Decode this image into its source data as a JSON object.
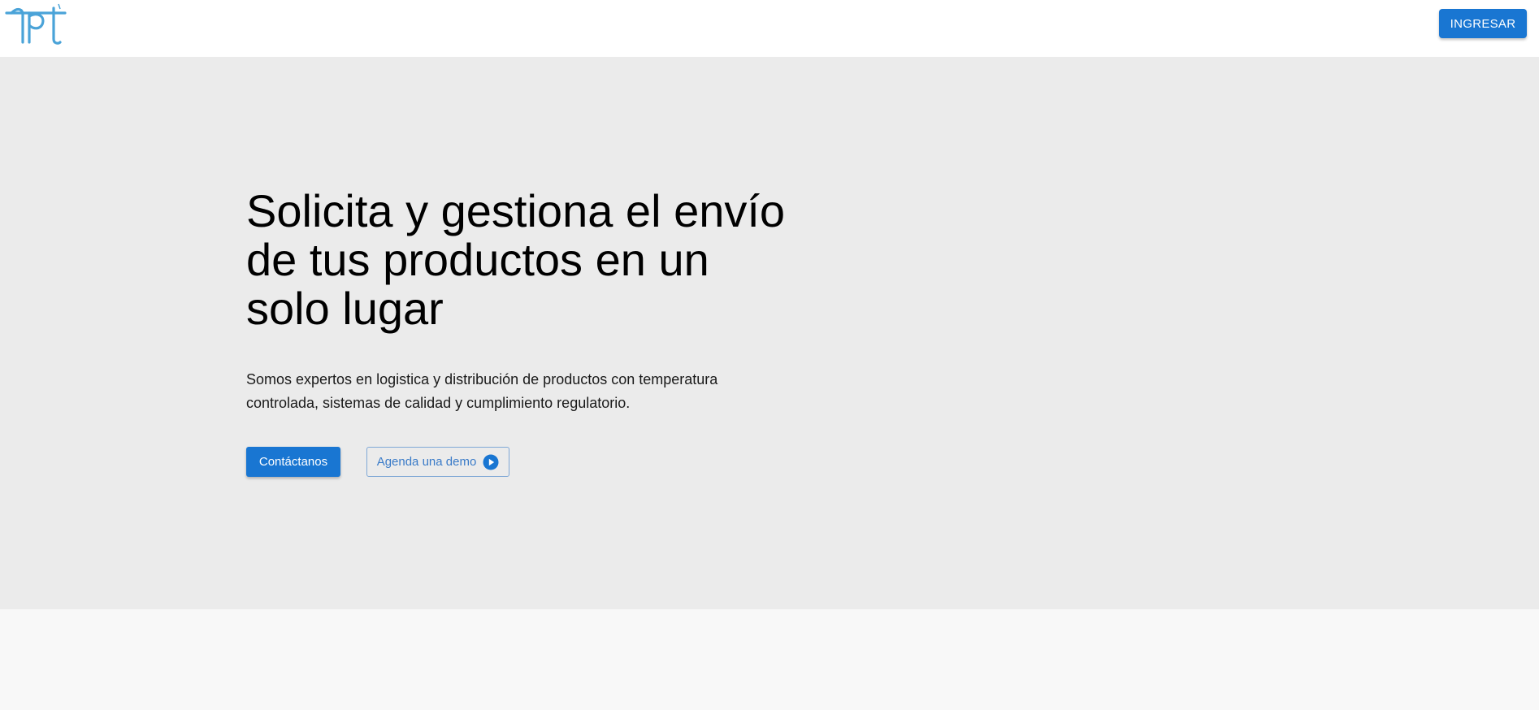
{
  "header": {
    "logo_icon": "tpl-logo-icon",
    "login_label": "INGRESAR"
  },
  "hero": {
    "title": "Solicita y gestiona el envío de tus productos en un solo lugar",
    "subtitle": "Somos expertos en logistica y distribución de productos con temperatura controlada, sistemas de calidad y cumplimiento regulatorio.",
    "contact_label": "Contáctanos",
    "demo_label": "Agenda una demo",
    "demo_icon": "play-circle-icon"
  },
  "colors": {
    "accent": "#1976d2",
    "hero_background": "#ebebeb",
    "page_background": "#f8f8f8",
    "logo": "#4aa3d8"
  }
}
